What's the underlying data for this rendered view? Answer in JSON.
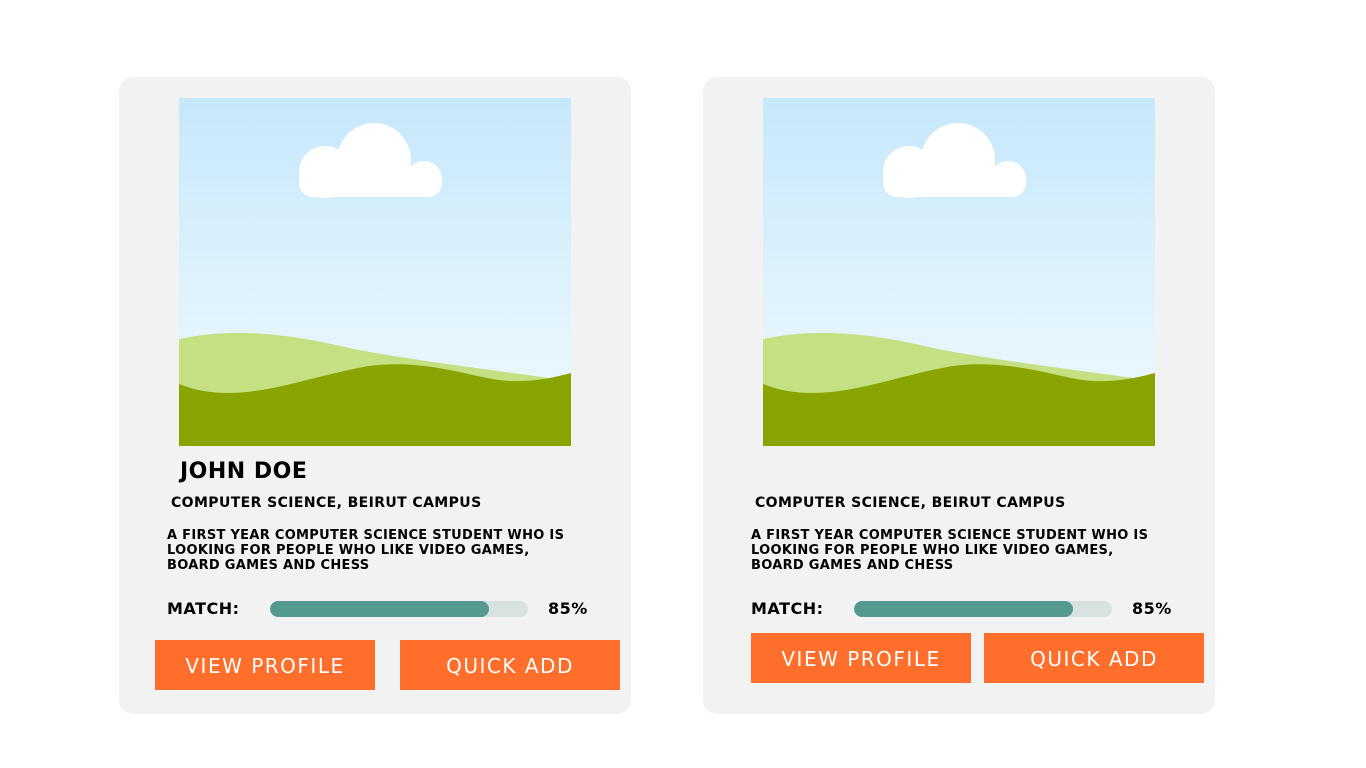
{
  "cards": [
    {
      "name": "JOHN DOE",
      "major": "COMPUTER SCIENCE, BEIRUT CAMPUS",
      "bio": "A FIRST YEAR COMPUTER SCIENCE STUDENT WHO IS LOOKING FOR PEOPLE WHO LIKE VIDEO GAMES, BOARD GAMES AND CHESS",
      "match_label": "MATCH:",
      "match_percent_text": "85%",
      "match_fraction": 0.85,
      "view_profile_label": "VIEW PROFILE",
      "quick_add_label": "QUICK ADD",
      "photo_icon": "image-placeholder-icon"
    },
    {
      "name": "",
      "major": "COMPUTER SCIENCE, BEIRUT CAMPUS",
      "bio": "A FIRST YEAR COMPUTER SCIENCE STUDENT WHO IS LOOKING FOR PEOPLE WHO LIKE VIDEO GAMES, BOARD GAMES AND CHESS",
      "match_label": "MATCH:",
      "match_percent_text": "85%",
      "match_fraction": 0.85,
      "view_profile_label": "VIEW PROFILE",
      "quick_add_label": "QUICK ADD",
      "photo_icon": "image-placeholder-icon"
    }
  ],
  "colors": {
    "card_background": "#f2f2f2",
    "button": "#ff6f2b",
    "match_bar": "#549a91"
  }
}
